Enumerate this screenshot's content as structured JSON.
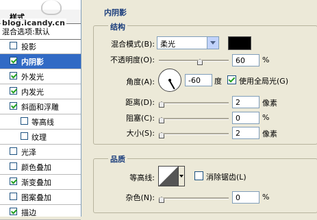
{
  "left_panel": {
    "title": "样式",
    "blend_options": "混合选项:默认",
    "watermark": "blog.icandy.cn",
    "items": [
      {
        "label": "投影",
        "checked": false,
        "selected": false,
        "indent": 0
      },
      {
        "label": "内阴影",
        "checked": true,
        "selected": true,
        "indent": 0
      },
      {
        "label": "外发光",
        "checked": true,
        "selected": false,
        "indent": 0
      },
      {
        "label": "内发光",
        "checked": true,
        "selected": false,
        "indent": 0
      },
      {
        "label": "斜面和浮雕",
        "checked": true,
        "selected": false,
        "indent": 0
      },
      {
        "label": "等高线",
        "checked": false,
        "selected": false,
        "indent": 1
      },
      {
        "label": "纹理",
        "checked": false,
        "selected": false,
        "indent": 1
      },
      {
        "label": "光泽",
        "checked": false,
        "selected": false,
        "indent": 0
      },
      {
        "label": "颜色叠加",
        "checked": false,
        "selected": false,
        "indent": 0
      },
      {
        "label": "渐变叠加",
        "checked": true,
        "selected": false,
        "indent": 0
      },
      {
        "label": "图案叠加",
        "checked": false,
        "selected": false,
        "indent": 0
      },
      {
        "label": "描边",
        "checked": true,
        "selected": false,
        "indent": 0
      }
    ]
  },
  "panel": {
    "title": "内阴影",
    "structure": {
      "title": "结构",
      "blend_mode_label": "混合模式(B):",
      "blend_mode_value": "柔光",
      "shadow_color": "#000000",
      "opacity_label": "不透明度(O):",
      "opacity_value": "60",
      "opacity_unit": "%",
      "opacity_fraction": 0.6,
      "angle_label": "角度(A):",
      "angle_value": "-60",
      "angle_unit": "度",
      "global_light_label": "使用全局光(G)",
      "global_light_checked": true,
      "distance_label": "距离(D):",
      "distance_value": "2",
      "distance_unit": "像素",
      "choke_label": "阻塞(C):",
      "choke_value": "0",
      "choke_unit": "%",
      "size_label": "大小(S):",
      "size_value": "2",
      "size_unit": "像素"
    },
    "quality": {
      "title": "品质",
      "contour_label": "等高线:",
      "anti_alias_label": "消除锯齿(L)",
      "anti_alias_checked": false,
      "noise_label": "杂色(N):",
      "noise_value": "0",
      "noise_unit": "%"
    }
  },
  "colors": {
    "selection": "#316ac5",
    "dialog_bg": "#ece9d8",
    "section_title": "#1a3d7c"
  },
  "icons": [
    "check-icon",
    "dropdown-arrow-icon",
    "slider-thumb-icon",
    "angle-dial-icon",
    "contour-preview-icon"
  ]
}
